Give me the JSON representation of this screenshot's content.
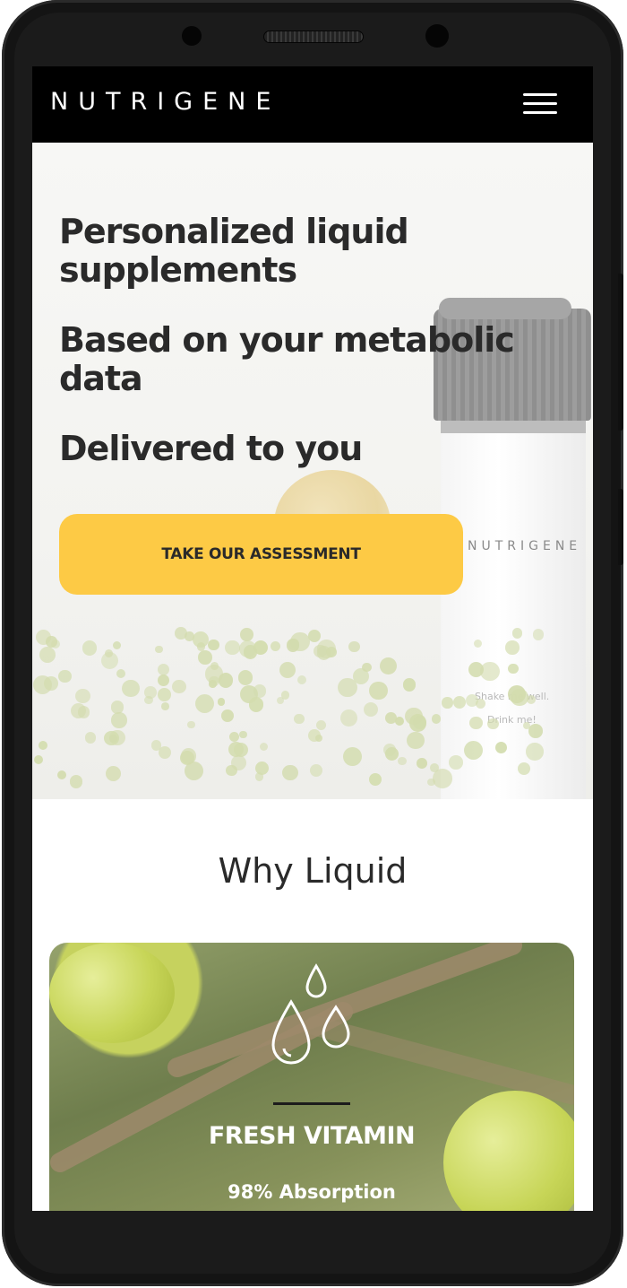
{
  "header": {
    "logo_text": "NUTRIGENE",
    "menu_icon": "hamburger-menu-icon"
  },
  "hero": {
    "headline_1": "Personalized liquid supplements",
    "headline_2": "Based on your metabolic data",
    "headline_3": "Delivered to you",
    "cta_label": "TAKE OUR ASSESSMENT",
    "bottle_brand": "NUTRIGENE",
    "bottle_line_1": "Shake me well.",
    "bottle_line_2": "Drink me!"
  },
  "why_section": {
    "title": "Why Liquid",
    "card": {
      "icon": "water-drops-icon",
      "title": "FRESH VITAMIN",
      "subtitle": "98% Absorption"
    }
  },
  "colors": {
    "accent": "#fdca45",
    "navbar": "#000000",
    "text_dark": "#2a2a2a"
  }
}
